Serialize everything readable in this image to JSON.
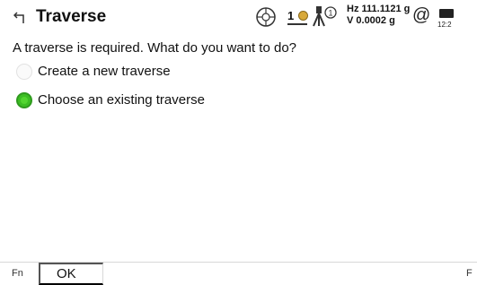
{
  "header": {
    "title": "Traverse",
    "back_icon": "back-arrow-icon",
    "prism_number": "1",
    "hz_label": "Hz 111.1121 g",
    "v_label": "V  0.0002 g",
    "at_symbol": "@",
    "battery_time": "12:2"
  },
  "main": {
    "question": "A traverse is required. What do you want to do?",
    "options": [
      {
        "label": "Create a new traverse",
        "selected": false
      },
      {
        "label": "Choose an existing traverse",
        "selected": true
      }
    ]
  },
  "footer": {
    "fn_left": "Fn",
    "ok_label": "OK",
    "fn_right": "F"
  },
  "colors": {
    "accent_green": "#3cbe23"
  }
}
